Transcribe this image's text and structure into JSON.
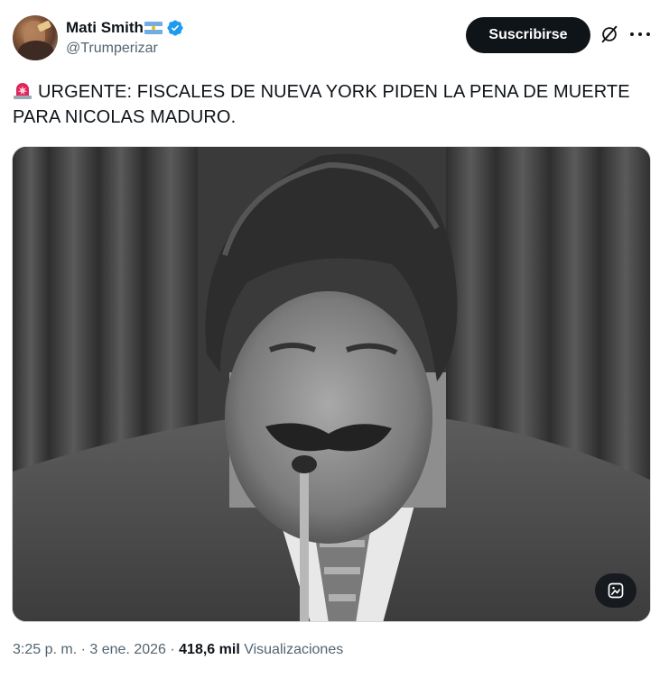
{
  "author": {
    "display_name": "Mati Smith",
    "handle": "@Trumperizar",
    "flag_icon": "argentina-flag-icon",
    "verified": true,
    "verified_color": "#1d9bf0"
  },
  "actions": {
    "subscribe_label": "Suscribirse",
    "grok_icon": "grok-icon",
    "more_icon": "more-icon"
  },
  "tweet": {
    "emoji_icon": "police-siren-icon",
    "text": "URGENTE: FISCALES DE NUEVA YORK PIDEN LA PENA DE MUERTE PARA NICOLAS MADURO."
  },
  "media": {
    "image_icon": "image-edit-icon"
  },
  "meta": {
    "time": "3:25 p. m.",
    "separator": "·",
    "date": "3 ene. 2026",
    "views_count": "418,6 mil",
    "views_label": "Visualizaciones"
  },
  "colors": {
    "text": "#0f1419",
    "secondary": "#536471",
    "button_bg": "#0f1419",
    "button_text": "#ffffff",
    "siren_red": "#e0245e"
  }
}
